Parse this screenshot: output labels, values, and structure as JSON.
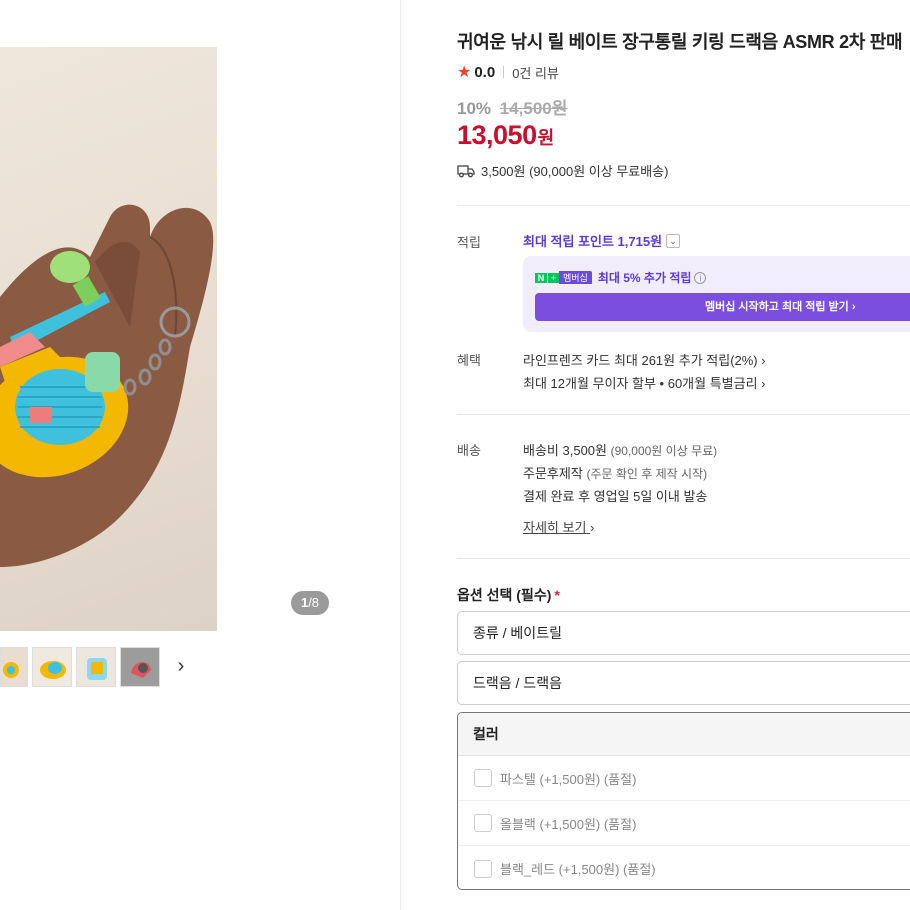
{
  "gallery": {
    "counter_current": "1",
    "counter_total": "/8",
    "next_icon": "chevron-right-icon"
  },
  "product": {
    "title": "귀여운 낚시 릴 베이트 장구통릴 키링 드랙음 ASMR 2차 판매",
    "rating": "0.0",
    "review_count": "0건 리뷰",
    "discount": "10%",
    "original_price": "14,500원",
    "price": "13,050",
    "price_unit": "원",
    "shipping_summary": "3,500원 (90,000원 이상 무료배송)"
  },
  "points": {
    "label": "적립",
    "max_points": "최대 적립 포인트 1,715원",
    "membership_badge": "멤버십",
    "membership_text": "최대 5% 추가 적립",
    "membership_button": "멤버십 시작하고 최대 적립 받기 ›"
  },
  "benefits": {
    "label": "혜택",
    "card": "라인프렌즈 카드 최대 261원 추가 적립(2%) ›",
    "installment": "최대 12개월 무이자 할부 • 60개월 특별금리 ›"
  },
  "delivery": {
    "label": "배송",
    "fee": "배송비 3,500원",
    "fee_note": "(90,000원 이상 무료)",
    "made_to_order": "주문후제작",
    "made_to_order_note": "(주문 확인 후 제작 시작)",
    "dispatch": "결제 완료 후 영업일 5일 이내 발송",
    "detail_link": "자세히 보기",
    "detail_chevron": "›"
  },
  "options": {
    "title": "옵션 선택 (필수)",
    "required_mark": "*",
    "type_select": "종류 / 베이트릴",
    "drag_select": "드랙음 / 드랙음",
    "color_header": "컬러",
    "colors": [
      "파스텔 (+1,500원) (품절)",
      "올블랙 (+1,500원) (품절)",
      "블랙_레드 (+1,500원) (품절)"
    ]
  },
  "colors": {
    "price_red": "#c8102e",
    "accent_purple": "#5b3bd1",
    "star": "#f0412b"
  }
}
